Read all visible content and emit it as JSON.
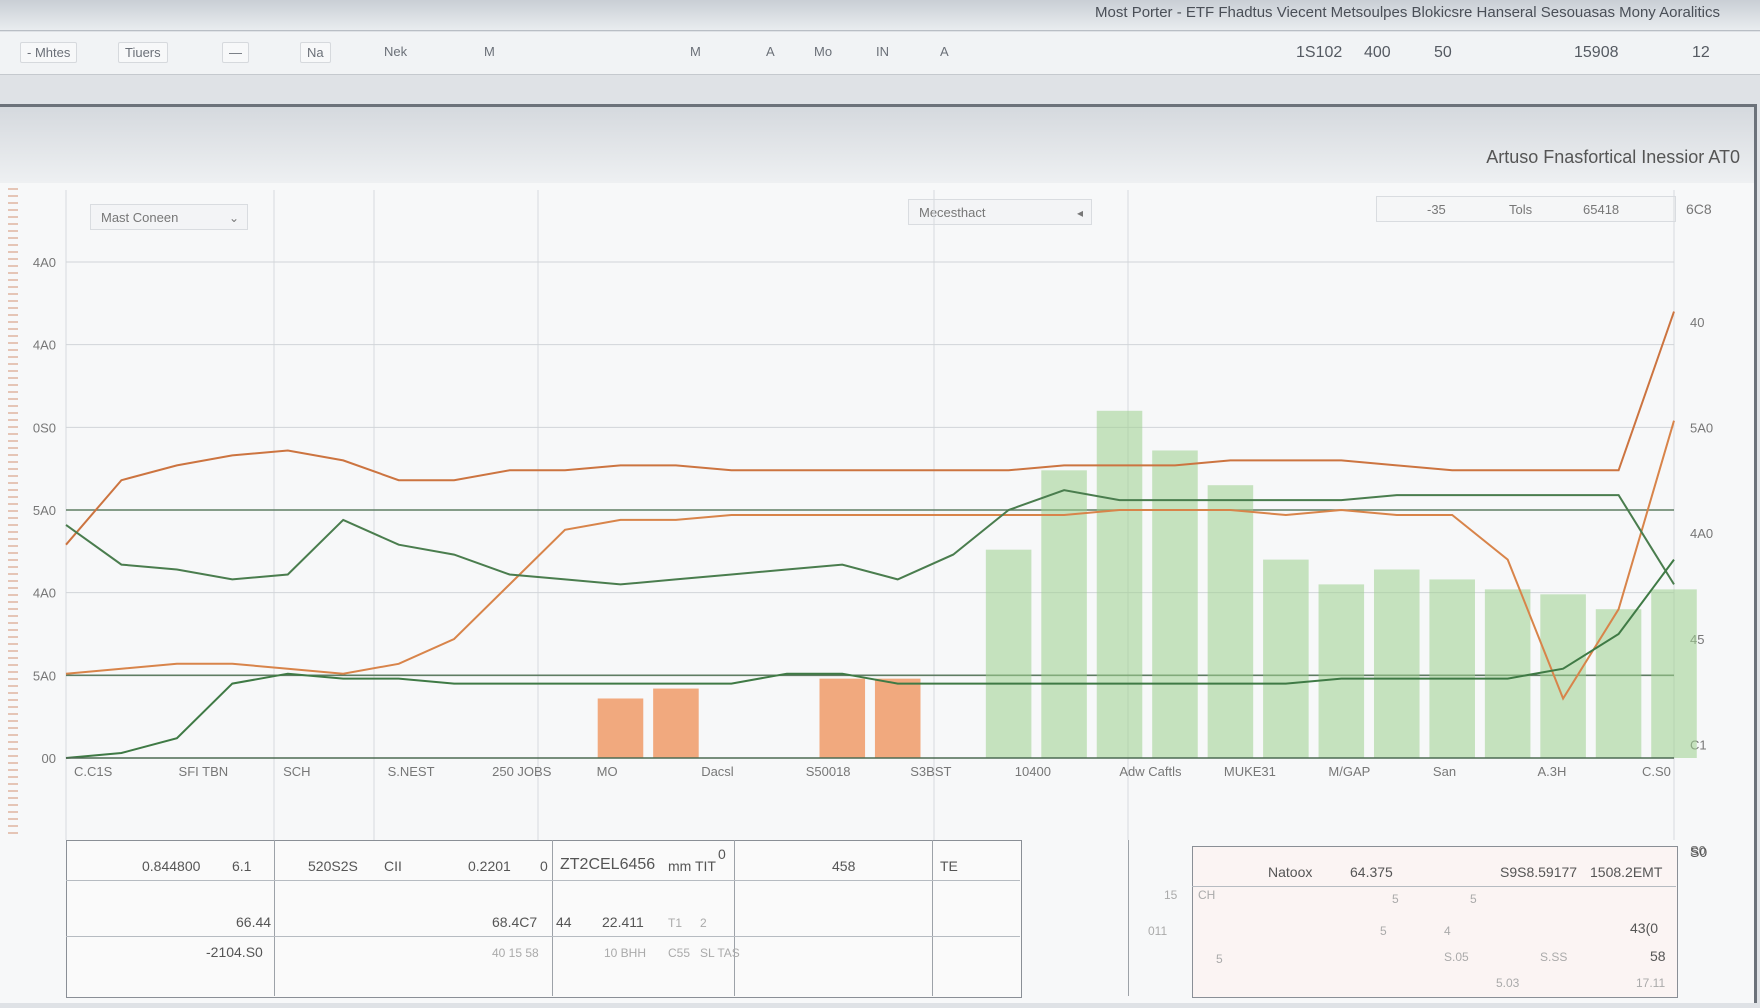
{
  "window": {
    "title": "Most Porter - ETF Fhadtus Viecent Metsoulpes Blokicsre Hanseral Sesouasas Mony Aoralitics"
  },
  "toolbar": {
    "items": [
      "- Mhtes",
      "Tiuers",
      "—",
      "Na",
      "Nek",
      "M",
      "M",
      "A",
      "Mo",
      "IN",
      "A"
    ],
    "values": [
      "1S102",
      "400",
      "50",
      "15908",
      "12"
    ]
  },
  "panel": {
    "title": "Artuso Fnasfortical Inessior AT0",
    "filter_left": "Mast Coneen",
    "filter_mid": "Mecesthact",
    "header_values": [
      "-35",
      "Tols",
      "65418",
      "6C8"
    ]
  },
  "chart_data": {
    "type": "line",
    "title": "Artuso Fnasfortical Inessior AT0",
    "y_left_ticks": [
      "4A0",
      "4A0",
      "0S0",
      "5A0",
      "4A0",
      "5A0",
      "00"
    ],
    "y_right_ticks": [
      "40",
      "5A0",
      "4A0",
      "45",
      "C1",
      "S0"
    ],
    "x_tick_labels": [
      "C.C1S",
      "SFI TBN",
      "SCH",
      "S.NEST",
      "250 JOBS",
      "MO",
      "Dacsl",
      "S50018",
      "S3BST",
      "10400",
      "Adw Caftls",
      "MUKE31",
      "M/GAP",
      "San",
      "A.3H",
      "C.S0"
    ],
    "x": [
      0,
      50,
      100,
      150,
      200,
      250,
      300,
      350,
      400,
      450,
      500,
      550,
      600,
      650,
      700,
      750,
      800,
      850,
      900,
      950,
      1000,
      1050,
      1100,
      1150,
      1200,
      1250,
      1300,
      1350,
      1400,
      1450
    ],
    "ylim": [
      0,
      100
    ],
    "series": [
      {
        "name": "",
        "color": "#d8844a",
        "values": [
          17,
          18,
          19,
          19,
          18,
          17,
          19,
          24,
          35,
          46,
          48,
          48,
          49,
          49,
          49,
          49,
          49,
          49,
          49,
          50,
          50,
          50,
          49,
          50,
          49,
          49,
          40,
          12,
          30,
          68
        ]
      },
      {
        "name": "",
        "color": "#cc7440",
        "values": [
          43,
          56,
          59,
          61,
          62,
          60,
          56,
          56,
          58,
          58,
          59,
          59,
          58,
          58,
          58,
          58,
          58,
          58,
          59,
          59,
          59,
          60,
          60,
          60,
          59,
          58,
          58,
          58,
          58,
          90
        ]
      },
      {
        "name": "",
        "color": "#4a7d4e",
        "values": [
          47,
          39,
          38,
          36,
          37,
          48,
          43,
          41,
          37,
          36,
          35,
          36,
          37,
          38,
          39,
          36,
          41,
          50,
          54,
          52,
          52,
          52,
          52,
          52,
          53,
          53,
          53,
          53,
          53,
          35
        ]
      },
      {
        "name": "",
        "color": "#3f7a45",
        "values": [
          0,
          1,
          4,
          15,
          17,
          16,
          16,
          15,
          15,
          15,
          15,
          15,
          15,
          17,
          17,
          15,
          15,
          15,
          15,
          15,
          15,
          15,
          15,
          16,
          16,
          16,
          16,
          18,
          25,
          40
        ]
      }
    ],
    "bars": {
      "orange_values": [
        0,
        0,
        0,
        0,
        0,
        0,
        0,
        0,
        0,
        0,
        12,
        14,
        0,
        0,
        16,
        16,
        0,
        0,
        0,
        0,
        0,
        0,
        0,
        0,
        0,
        0,
        0,
        0,
        0,
        0
      ],
      "green_values": [
        0,
        0,
        0,
        0,
        0,
        0,
        0,
        0,
        0,
        0,
        0,
        0,
        0,
        0,
        0,
        0,
        0,
        42,
        58,
        70,
        62,
        55,
        40,
        35,
        38,
        36,
        34,
        33,
        30,
        34
      ],
      "orange_color": "#f0a070",
      "green_color": "#9ccf8e"
    },
    "grid": true
  },
  "table": {
    "header_row": [
      "0.844800",
      "6.1",
      "520S2S",
      "CII",
      "0.2201",
      "0",
      "ZT2CEL6456",
      "mm TIT",
      "0",
      "458",
      "TE"
    ],
    "right_header": [
      "Natoox",
      "64.375",
      "S9S8.59177",
      "1508.2EMT"
    ],
    "rows": [
      [
        "66.44",
        "",
        "68.4C7",
        "44",
        "22.411",
        "T1",
        "2"
      ],
      [
        "-2104.S0",
        "",
        "40 15 58",
        "",
        "10 BHH",
        "C55",
        "SL TAS"
      ]
    ],
    "right_rows": [
      [
        "15",
        "CH",
        "5",
        "5",
        ""
      ],
      [
        "011",
        "",
        "5",
        "4",
        "43(0"
      ],
      [
        "",
        "5",
        "S.05",
        "S.SS",
        "58"
      ],
      [
        "",
        "",
        "5.03",
        "",
        "17.11"
      ]
    ],
    "side_label": "S0"
  }
}
